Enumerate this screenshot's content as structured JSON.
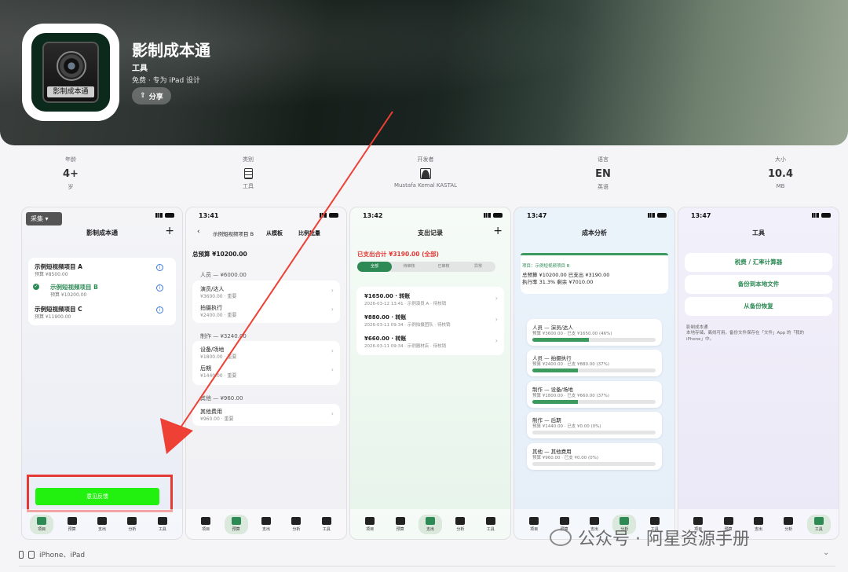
{
  "app": {
    "name": "影制成本通",
    "category": "工具",
    "subtitle": "免费 · 专为 iPad 设计",
    "share": "分享",
    "icon_text": "影制成本通"
  },
  "info": [
    {
      "label": "年龄",
      "value": "4+",
      "unit": "岁"
    },
    {
      "label": "类别",
      "value": "",
      "unit": "工具"
    },
    {
      "label": "开发者",
      "value": "",
      "unit": "Mustafa Kemal KASTAL"
    },
    {
      "label": "语言",
      "value": "EN",
      "unit": "英语"
    },
    {
      "label": "大小",
      "value": "10.4",
      "unit": "MB"
    }
  ],
  "tabs": [
    "项目",
    "预算",
    "支出",
    "分析",
    "工具"
  ],
  "s1": {
    "tag": "采集",
    "title": "影制成本通",
    "projects": [
      {
        "name": "示例短视频项目 A",
        "budget": "预算 ¥8500.00"
      },
      {
        "name": "示例短视频项目 B",
        "budget": "预算 ¥10200.00"
      },
      {
        "name": "示例短视频项目 C",
        "budget": "预算 ¥11900.00"
      }
    ],
    "feedback": "意见反馈"
  },
  "s2": {
    "time": "13:41",
    "back_title": "示例短视频项目 B",
    "btn1": "从模板",
    "btn2": "比例批量",
    "total": "总预算 ¥10200.00",
    "groups": [
      {
        "head": "人员 — ¥6000.00",
        "items": [
          {
            "n": "演员/达人",
            "v": "¥3600.00 · 重要"
          },
          {
            "n": "拍摄执行",
            "v": "¥2400.00 · 重要"
          }
        ]
      },
      {
        "head": "制作 — ¥3240.00",
        "items": [
          {
            "n": "设备/场地",
            "v": "¥1800.00 · 重要"
          },
          {
            "n": "后期",
            "v": "¥1440.00 · 重要"
          }
        ]
      },
      {
        "head": "其他 — ¥960.00",
        "items": [
          {
            "n": "其他费用",
            "v": "¥960.00 · 重要"
          }
        ]
      }
    ]
  },
  "s3": {
    "time": "13:42",
    "title": "支出记录",
    "total": "已支出合计 ¥3190.00 (全部)",
    "filters": [
      "全部",
      "待审核",
      "已审核",
      "异常"
    ],
    "records": [
      {
        "amt": "¥1650.00 · 转账",
        "meta": "2026-03-12 13:41 · 示例演员 A · 待核销"
      },
      {
        "amt": "¥880.00 · 转账",
        "meta": "2026-03-11 09:34 · 示例拍摄团队 · 待核销"
      },
      {
        "amt": "¥660.00 · 转账",
        "meta": "2026-03-11 09:34 · 示例器材店 · 待核销"
      }
    ]
  },
  "s4": {
    "time": "13:47",
    "title": "成本分析",
    "proj": "项目：示例短视频项目 B",
    "summary1": "总预算 ¥10200.00  已支出 ¥3190.00",
    "summary2": "执行率 31.3%  剩余 ¥7010.00",
    "items": [
      {
        "n": "人员 — 演员/达人",
        "v": "预算 ¥3600.00 · 已支 ¥1650.00 (46%)",
        "pct": 0.46
      },
      {
        "n": "人员 — 拍摄执行",
        "v": "预算 ¥2400.00 · 已支 ¥880.00 (37%)",
        "pct": 0.37
      },
      {
        "n": "制作 — 设备/场地",
        "v": "预算 ¥1800.00 · 已支 ¥660.00 (37%)",
        "pct": 0.37
      },
      {
        "n": "制作 — 后期",
        "v": "预算 ¥1440.00 · 已支 ¥0.00 (0%)",
        "pct": 0
      },
      {
        "n": "其他 — 其他费用",
        "v": "预算 ¥960.00 · 已支 ¥0.00 (0%)",
        "pct": 0
      }
    ]
  },
  "s5": {
    "time": "13:47",
    "title": "工具",
    "buttons": [
      "税费 / 汇率计算器",
      "备份到本地文件",
      "从备份恢复"
    ],
    "note1": "影制成本通",
    "note2": "本地存储，离线可用。备份文件保存在「文件」App 的「我的 iPhone」中。"
  },
  "footer": {
    "devices": "iPhone、iPad"
  },
  "watermark": "公众号 · 阿星资源手册",
  "colors": {
    "green": "#2e8a55",
    "red": "#e53935",
    "highlight": "#22f00f"
  }
}
